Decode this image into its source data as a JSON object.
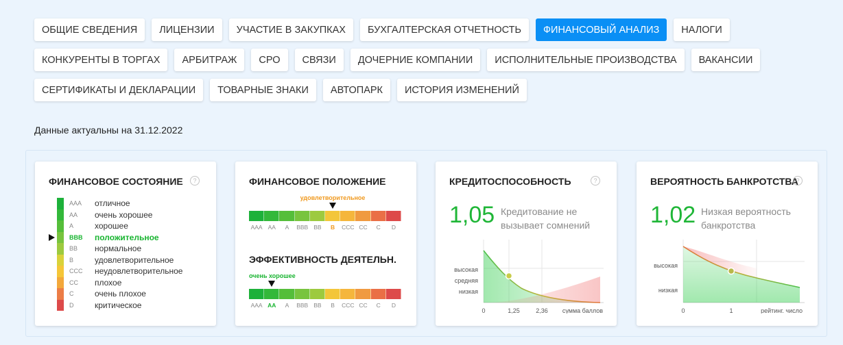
{
  "tabs": [
    [
      "ОБЩИЕ СВЕДЕНИЯ",
      "ЛИЦЕНЗИИ",
      "УЧАСТИЕ В ЗАКУПКАХ",
      "БУХГАЛТЕРСКАЯ ОТЧЕТНОСТЬ",
      "ФИНАНСОВЫЙ АНАЛИЗ",
      "НАЛОГИ"
    ],
    [
      "КОНКУРЕНТЫ В ТОРГАХ",
      "АРБИТРАЖ",
      "СРО",
      "СВЯЗИ",
      "ДОЧЕРНИЕ КОМПАНИИ",
      "ИСПОЛНИТЕЛЬНЫЕ ПРОИЗВОДСТВА",
      "ВАКАНСИИ"
    ],
    [
      "СЕРТИФИКАТЫ И ДЕКЛАРАЦИИ",
      "ТОВАРНЫЕ ЗНАКИ",
      "АВТОПАРК",
      "ИСТОРИЯ ИЗМЕНЕНИЙ"
    ]
  ],
  "active_tab": "ФИНАНСОВЫЙ АНАЛИЗ",
  "actual_date": "Данные актуальны на 31.12.2022",
  "help_symbol": "?",
  "fin_state": {
    "title": "ФИНАНСОВОЕ СОСТОЯНИЕ",
    "current": "BBB",
    "ratings": [
      {
        "code": "AAA",
        "label": "отличное",
        "color": "#1db13a"
      },
      {
        "code": "AA",
        "label": "очень хорошее",
        "color": "#33b83a"
      },
      {
        "code": "A",
        "label": "хорошее",
        "color": "#55be3a"
      },
      {
        "code": "BBB",
        "label": "положительное",
        "color": "#78c43e"
      },
      {
        "code": "BB",
        "label": "нормальное",
        "color": "#9dca3f"
      },
      {
        "code": "B",
        "label": "удовлетворительное",
        "color": "#d9d23a"
      },
      {
        "code": "CCC",
        "label": "неудовлетворительное",
        "color": "#f5c638"
      },
      {
        "code": "CC",
        "label": "плохое",
        "color": "#f3a83b"
      },
      {
        "code": "C",
        "label": "очень плохое",
        "color": "#ec7d46"
      },
      {
        "code": "D",
        "label": "критическое",
        "color": "#dd4a4a"
      }
    ]
  },
  "fin_position": {
    "title": "ФИНАНСОВОЕ ПОЛОЖЕНИЕ",
    "marker_label": "удовлетворительное",
    "marker_color": "#f09a20",
    "current": "B",
    "codes": [
      "AAA",
      "AA",
      "A",
      "BBB",
      "BB",
      "B",
      "CCC",
      "CC",
      "C",
      "D"
    ],
    "colors": [
      "#1db13a",
      "#33b83a",
      "#55be3a",
      "#78c43e",
      "#9dca3f",
      "#f3c63a",
      "#f5b63c",
      "#f09a40",
      "#ea6f46",
      "#dd4a4a"
    ]
  },
  "efficiency": {
    "title": "ЭФФЕКТИВНОСТЬ ДЕЯТЕЛЬН.",
    "marker_label": "очень хорошее",
    "marker_color": "#18b430",
    "current": "AA",
    "codes": [
      "AAA",
      "AA",
      "A",
      "BBB",
      "BB",
      "B",
      "CCC",
      "CC",
      "C",
      "D"
    ],
    "colors": [
      "#1db13a",
      "#33b83a",
      "#55be3a",
      "#78c43e",
      "#9dca3f",
      "#f3c63a",
      "#f5b63c",
      "#f09a40",
      "#ea6f46",
      "#dd4a4a"
    ]
  },
  "credit": {
    "title": "КРЕДИТОСПОСОБНОСТЬ",
    "value": "1,05",
    "description": "Кредитование не вызывает сомнений",
    "y_labels": [
      "высокая",
      "средняя",
      "низкая"
    ],
    "x_labels": [
      "0",
      "1,25",
      "2,36",
      "сумма баллов"
    ],
    "chart_data": {
      "type": "line",
      "x_ticks": [
        0,
        1.25,
        2.36
      ],
      "point": {
        "x": 1.05
      },
      "xlabel": "сумма баллов"
    }
  },
  "bankruptcy": {
    "title": "ВЕРОЯТНОСТЬ БАНКРОТСТВА",
    "value": "1,02",
    "description": "Низкая вероятность банкротства",
    "y_labels": [
      "высокая",
      "низкая"
    ],
    "x_labels": [
      "0",
      "1",
      "рейтинг. число"
    ],
    "chart_data": {
      "type": "line",
      "x_ticks": [
        0,
        1
      ],
      "point": {
        "x": 1.02
      },
      "xlabel": "рейтинг. число"
    }
  }
}
